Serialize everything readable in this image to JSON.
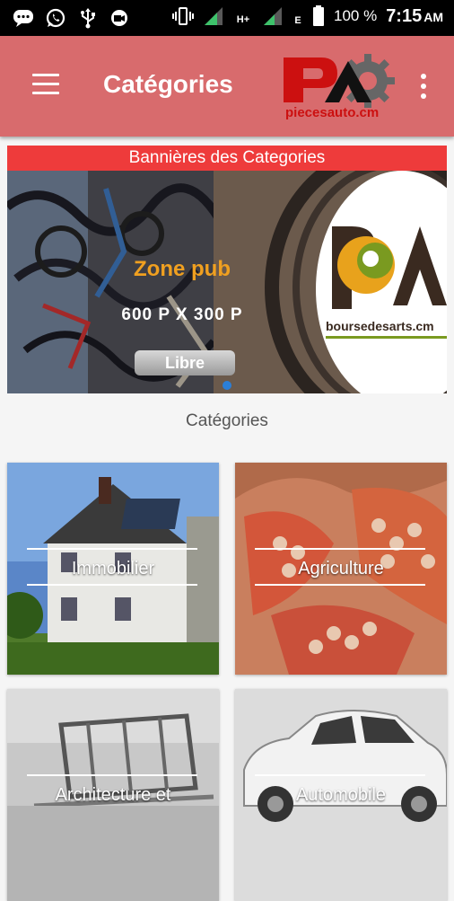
{
  "status_bar": {
    "battery": "100 %",
    "time": "7:15",
    "ampm": "AM",
    "network": "H+",
    "sim": "E"
  },
  "app_bar": {
    "title": "Catégories",
    "logo_text": "piecesauto.cm"
  },
  "banner": {
    "header": "Bannières des Categories",
    "pub_title": "Zone pub",
    "pub_size": "600 P X 300 P",
    "libre_label": "Libre",
    "partner_text": "boursedesarts.cm"
  },
  "categories_title": "Catégories",
  "categories": [
    {
      "label": "Immobilier"
    },
    {
      "label": "Agriculture"
    },
    {
      "label": "Architecture et"
    },
    {
      "label": "Automobile"
    }
  ],
  "colors": {
    "appbar": "#d86b6d",
    "banner_header": "#ee3b3b",
    "pub_title": "#f0a020",
    "indicator": "#2b7fd8"
  }
}
